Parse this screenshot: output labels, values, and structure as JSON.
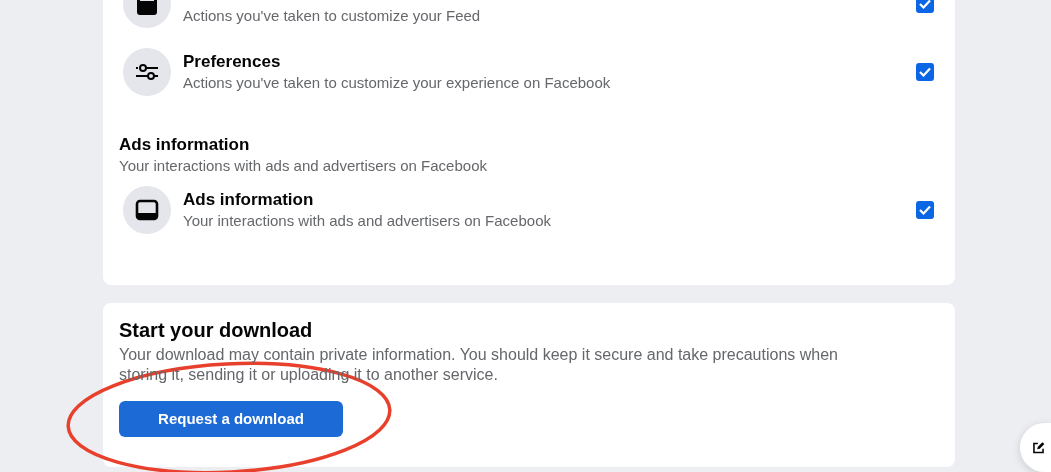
{
  "sections": [
    {
      "items": [
        {
          "description": "Actions you've taken to customize your Feed",
          "checked": true
        },
        {
          "title": "Preferences",
          "description": "Actions you've taken to customize your experience on Facebook",
          "checked": true
        }
      ]
    },
    {
      "heading": "Ads information",
      "subheading": "Your interactions with ads and advertisers on Facebook",
      "items": [
        {
          "title": "Ads information",
          "description": "Your interactions with ads and advertisers on Facebook",
          "checked": true
        }
      ]
    }
  ],
  "download": {
    "title": "Start your download",
    "text": "Your download may contain private information. You should keep it secure and take precautions when storing it, sending it or uploading it to another service.",
    "button": "Request a download"
  }
}
